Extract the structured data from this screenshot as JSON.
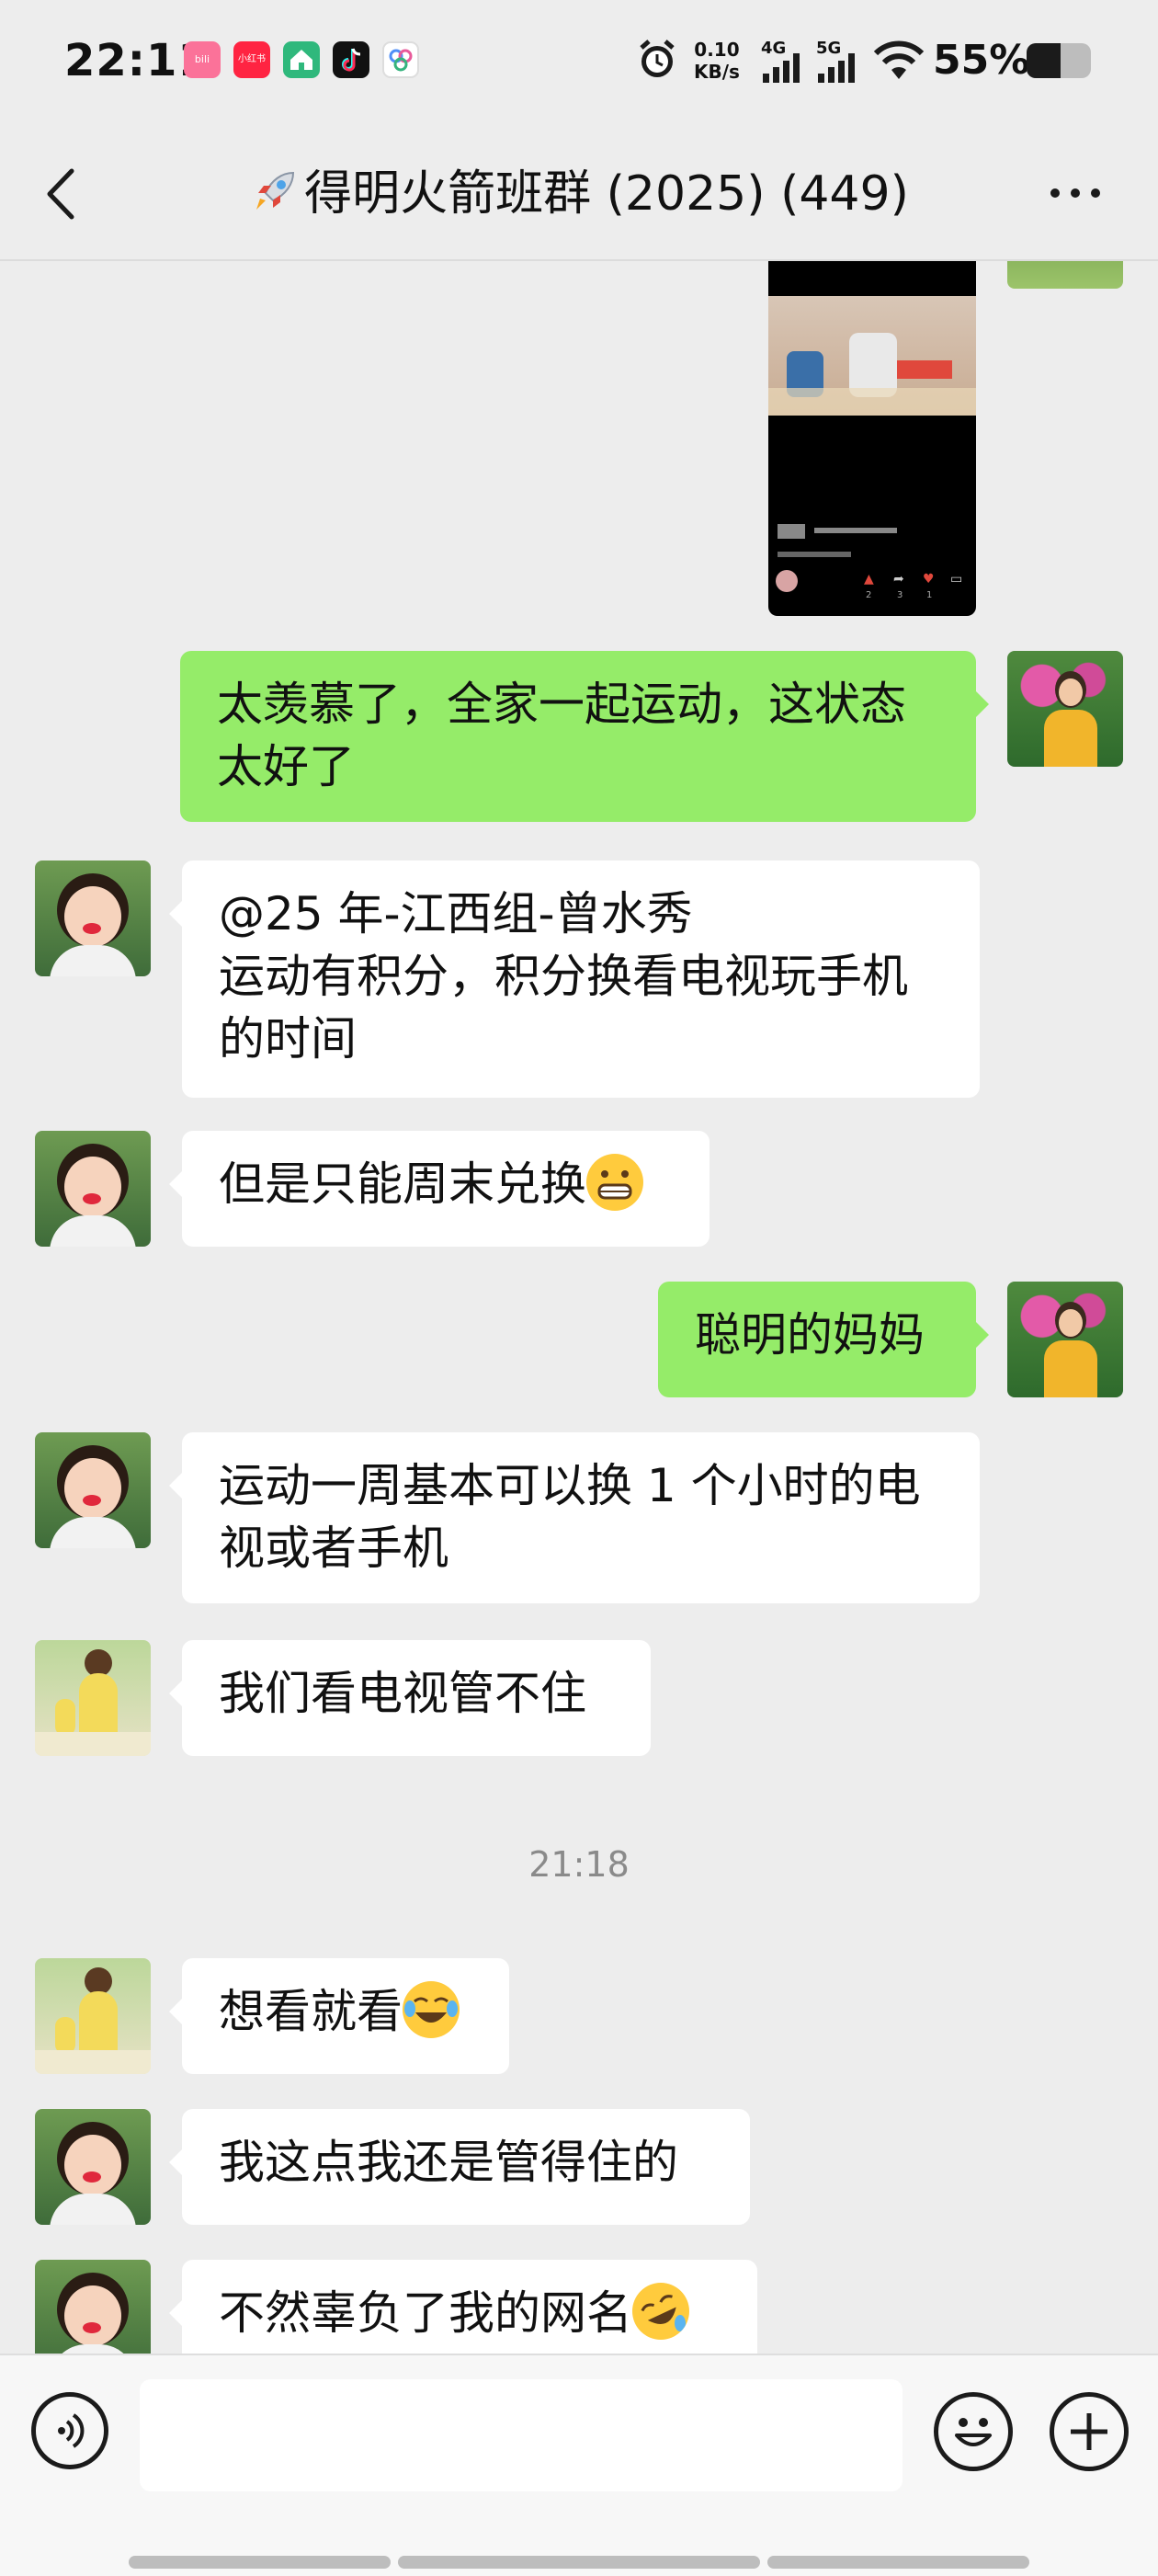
{
  "status_bar": {
    "time": "22:11",
    "app_icons": [
      {
        "name": "bilibili-icon",
        "label": "bili",
        "color": "#fb7299"
      },
      {
        "name": "xiaohongshu-icon",
        "label": "小红书",
        "color": "#ff2442"
      },
      {
        "name": "home-app-icon",
        "label": "",
        "color": "#2fb87c"
      },
      {
        "name": "tiktok-icon",
        "label": "",
        "color": "#111111"
      },
      {
        "name": "cloud-app-icon",
        "label": "",
        "color": "#4f8ef7"
      }
    ],
    "net_speed_value": "0.10",
    "net_speed_unit": "KB/s",
    "signal_1": "4G",
    "signal_2": "5G",
    "battery": "55%"
  },
  "header": {
    "title": "得明火箭班群 (2025) (449)",
    "title_icon": "rocket-icon"
  },
  "messages": [
    {
      "side": "in",
      "type": "video-card",
      "avatar": "avatar-sender-partial",
      "card_stats": [
        "2",
        "3",
        "1"
      ]
    },
    {
      "side": "out",
      "type": "text",
      "avatar": "avatar-self",
      "text": "太羡慕了，全家一起运动，这状态太好了"
    },
    {
      "side": "in",
      "type": "text",
      "avatar": "avatar-child",
      "text_lines": [
        "@25 年-江西组-曾水秀",
        "运动有积分，积分换看电视玩手机的时间"
      ]
    },
    {
      "side": "in",
      "type": "text",
      "avatar": "avatar-child",
      "text": "但是只能周末兑换",
      "emoji": "grinning-emoji"
    },
    {
      "side": "out",
      "type": "text",
      "avatar": "avatar-self",
      "text": "聪明的妈妈"
    },
    {
      "side": "in",
      "type": "text",
      "avatar": "avatar-child",
      "text": "运动一周基本可以换 1 个小时的电视或者手机"
    },
    {
      "side": "in",
      "type": "text",
      "avatar": "avatar-illustration",
      "text": "我们看电视管不住"
    },
    {
      "side": "center",
      "type": "timestamp",
      "text": "21:18"
    },
    {
      "side": "in",
      "type": "text",
      "avatar": "avatar-illustration",
      "text": "想看就看",
      "emoji": "tears-of-joy-emoji"
    },
    {
      "side": "in",
      "type": "text",
      "avatar": "avatar-child",
      "text": "我这点我还是管得住的"
    },
    {
      "side": "in",
      "type": "text",
      "avatar": "avatar-child",
      "text": "不然辜负了我的网名",
      "emoji": "rofl-emoji"
    }
  ],
  "input_bar": {
    "voice_icon": "voice-icon",
    "emoji_icon": "emoji-icon",
    "add_icon": "plus-icon"
  },
  "colors": {
    "chat_bg": "#ededed",
    "out_bubble": "#95ec69",
    "in_bubble": "#ffffff"
  }
}
